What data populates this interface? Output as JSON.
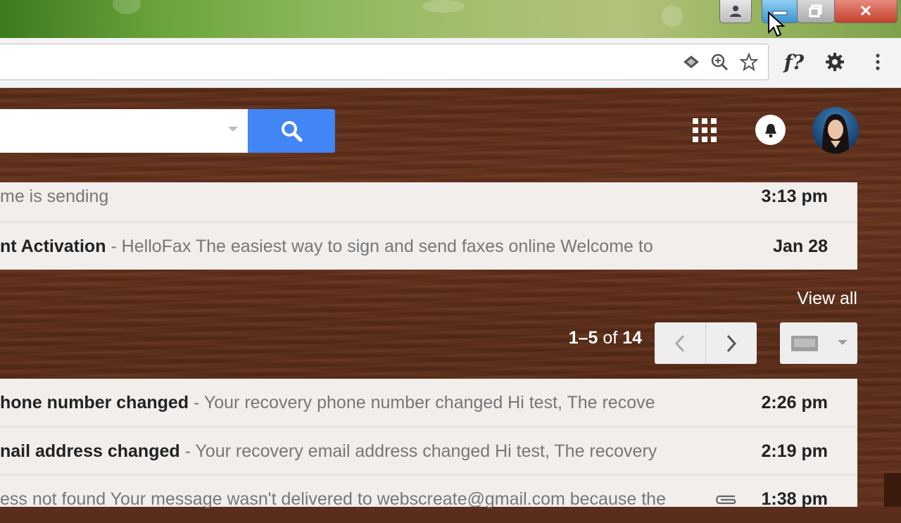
{
  "window": {
    "buttons": {
      "user_icon": "user-icon",
      "minimize_icon": "minimize-icon",
      "maximize_icon": "maximize-icon",
      "close_glyph": "✕"
    }
  },
  "toolbar": {
    "icons": [
      "extension-diamond-icon",
      "zoom-icon",
      "bookmark-star-icon"
    ],
    "font_ext_label": "f?",
    "menu_icons": [
      "gear-icon",
      "kebab-menu-icon"
    ]
  },
  "header": {
    "search_placeholder": "",
    "search_button_icon": "search-icon",
    "apps_icon": "apps-grid-icon",
    "notifications_icon": "bell-icon",
    "avatar": "account-avatar"
  },
  "top_list": [
    {
      "sender": "",
      "subject": "",
      "snippet": "me is sending",
      "time": "3:13 pm"
    },
    {
      "sender": "",
      "subject": "nt Activation",
      "snippet": " - HelloFax The easiest way to sign and send faxes online Welcome to",
      "time": "Jan 28"
    }
  ],
  "section": {
    "view_all": "View all",
    "pagination_range": "1–5",
    "pagination_of": " of ",
    "pagination_total": "14"
  },
  "bottom_list": [
    {
      "subject": "hone number changed",
      "snippet": " - Your recovery phone number changed Hi test, The recove",
      "time": "2:26 pm",
      "attachment": false
    },
    {
      "subject": "nail address changed",
      "snippet": " - Your recovery email address changed Hi test, The recovery",
      "time": "2:19 pm",
      "attachment": false
    },
    {
      "subject": "",
      "snippet": "ess not found Your message wasn't delivered to webscreate@gmail.com because the",
      "time": "1:38 pm",
      "attachment": true
    }
  ],
  "colors": {
    "search_button": "#4285f4",
    "panel_bg": "#f1eeec",
    "wood": "#5e2f1b"
  }
}
